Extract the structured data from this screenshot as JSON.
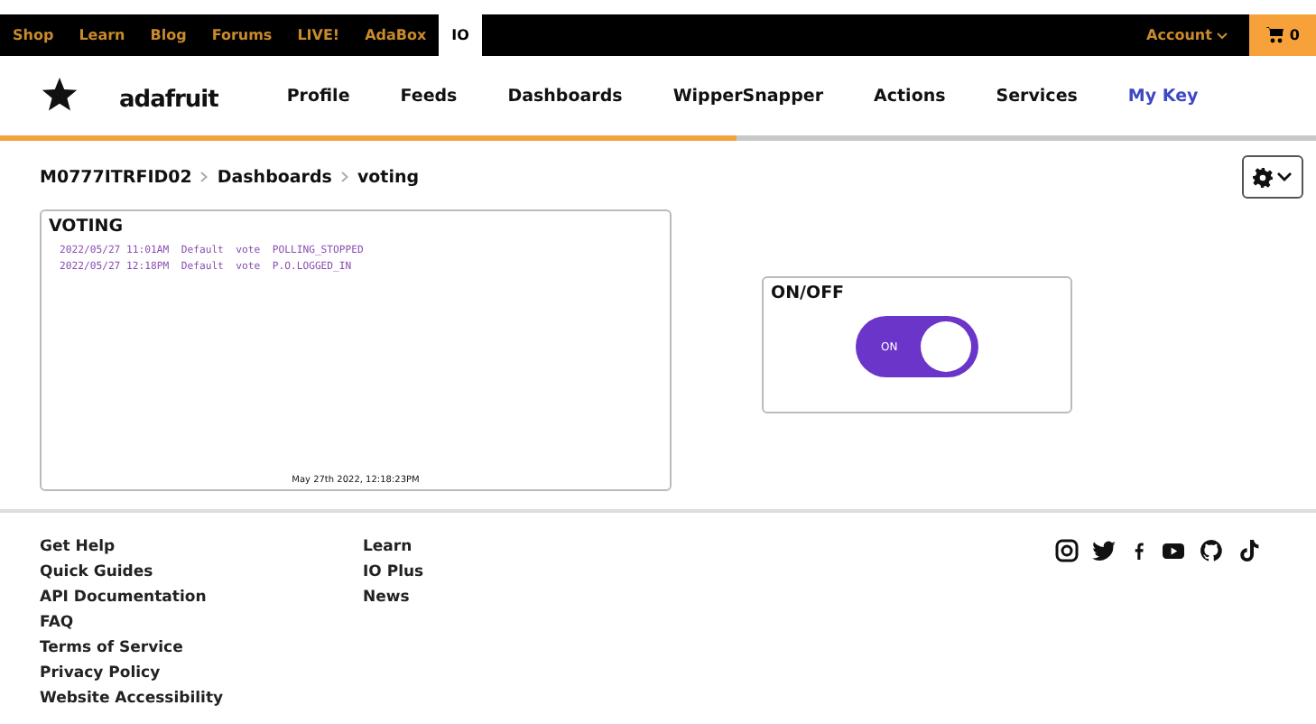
{
  "top_bar": {
    "links": [
      {
        "label": "Shop",
        "selected": false
      },
      {
        "label": "Learn",
        "selected": false
      },
      {
        "label": "Blog",
        "selected": false
      },
      {
        "label": "Forums",
        "selected": false
      },
      {
        "label": "LIVE!",
        "selected": false
      },
      {
        "label": "AdaBox",
        "selected": false
      },
      {
        "label": "IO",
        "selected": true
      }
    ],
    "account": "Account",
    "cart_count": "0"
  },
  "nav": {
    "brand": "adafruit",
    "items": [
      {
        "label": "Profile",
        "selected": false
      },
      {
        "label": "Feeds",
        "selected": false
      },
      {
        "label": "Dashboards",
        "selected": false
      },
      {
        "label": "WipperSnapper",
        "selected": false
      },
      {
        "label": "Actions",
        "selected": false
      },
      {
        "label": "Services",
        "selected": false
      },
      {
        "label": "My Key",
        "selected": true
      }
    ]
  },
  "breadcrumb": [
    "M0777ITRFID02",
    "Dashboards",
    "voting"
  ],
  "stream_block": {
    "title": "VOTING",
    "lines": [
      "2022/05/27 11:01AM  Default  vote  POLLING_STOPPED",
      "2022/05/27 12:18PM  Default  vote  P.O.LOGGED_IN"
    ],
    "timestamp": "May 27th 2022, 12:18:23PM"
  },
  "toggle_block": {
    "title": "ON/OFF",
    "on": true,
    "label": "ON"
  },
  "footer": {
    "columns": [
      [
        "Get Help",
        "Quick Guides",
        "API Documentation",
        "FAQ",
        "Terms of Service",
        "Privacy Policy",
        "Website Accessibility"
      ],
      [
        "Learn",
        "IO Plus",
        "News"
      ]
    ]
  }
}
